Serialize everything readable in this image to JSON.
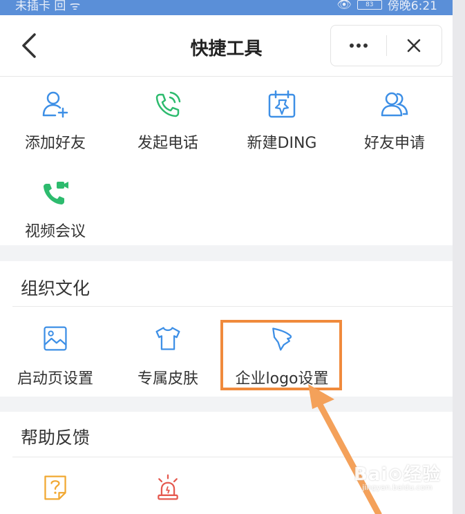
{
  "status_bar": {
    "carrier": "未插卡 回 ᯤ",
    "battery": "83",
    "time": "傍晚6:21"
  },
  "nav": {
    "title": "快捷工具"
  },
  "tools_section": {
    "items": [
      {
        "label": "添加好友"
      },
      {
        "label": "发起电话"
      },
      {
        "label": "新建DING"
      },
      {
        "label": "好友申请"
      },
      {
        "label": "视频会议"
      }
    ]
  },
  "culture_section": {
    "title": "组织文化",
    "items": [
      {
        "label": "启动页设置"
      },
      {
        "label": "专属皮肤"
      },
      {
        "label": "企业logo设置"
      }
    ]
  },
  "help_section": {
    "title": "帮助反馈"
  },
  "watermark": {
    "brand": "Bai⊙经验",
    "url": "jingyan.baidu.com"
  },
  "colors": {
    "blue_icon": "#3d8fe6",
    "green_icon": "#2dbb6e",
    "red_icon": "#e5594f",
    "yellow_icon": "#f1a832",
    "highlight": "#f08a3c"
  }
}
